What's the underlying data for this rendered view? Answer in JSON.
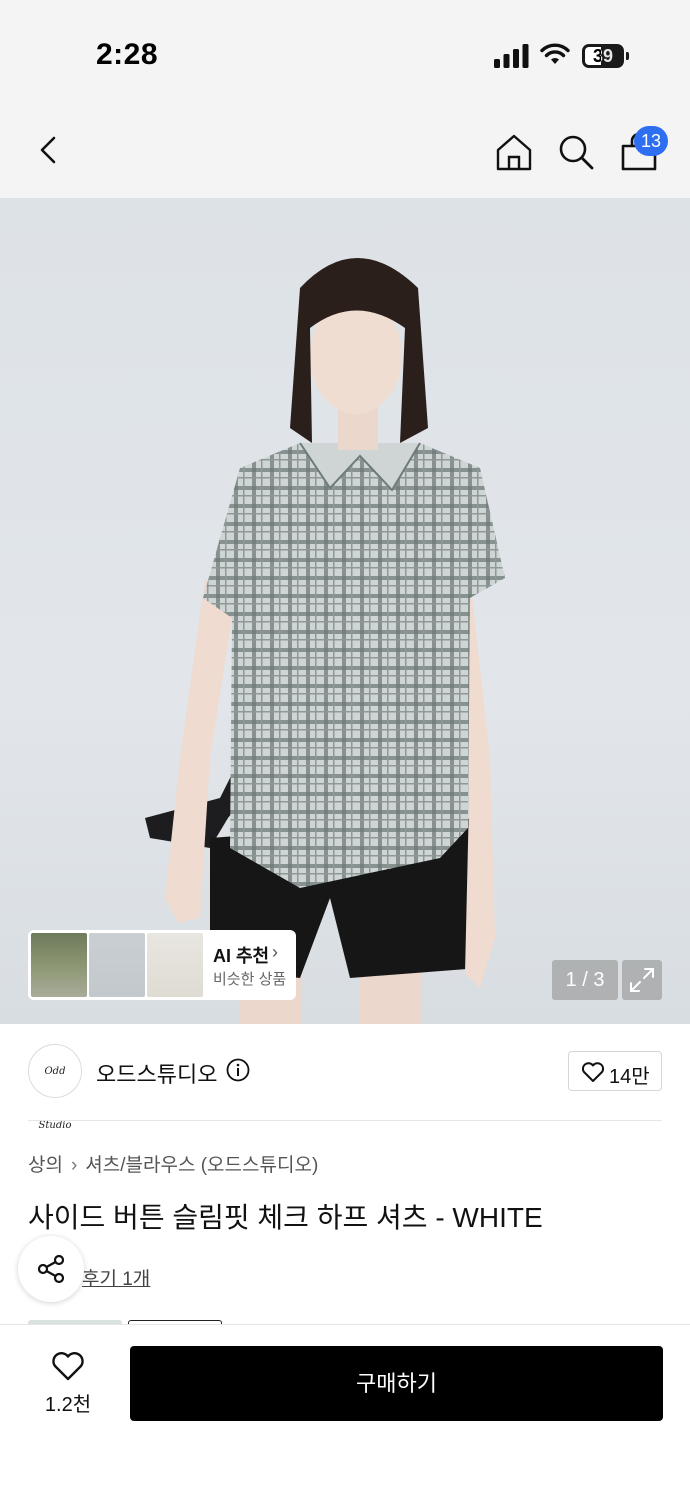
{
  "status_bar": {
    "time": "2:28",
    "battery": "39"
  },
  "header": {
    "cart_count": "13"
  },
  "hero": {
    "ai_title": "AI 추천",
    "ai_subtitle": "비슷한 상품",
    "page_indicator": "1 / 3"
  },
  "brand": {
    "logo_text": "Odd Studio",
    "name": "오드스튜디오",
    "likes": "14만"
  },
  "breadcrumb": {
    "category": "상의",
    "subcategory": "셔츠/블라우스 (오드스튜디오)"
  },
  "product": {
    "title": "사이드 버튼 슬림핏 체크 하프 셔츠 - WHITE",
    "review_link": "후기 1개"
  },
  "bottom_bar": {
    "wish_count": "1.2천",
    "buy_label": "구매하기"
  },
  "colors": {
    "accent_badge": "#2e6ff2",
    "buy_button": "#000000"
  }
}
